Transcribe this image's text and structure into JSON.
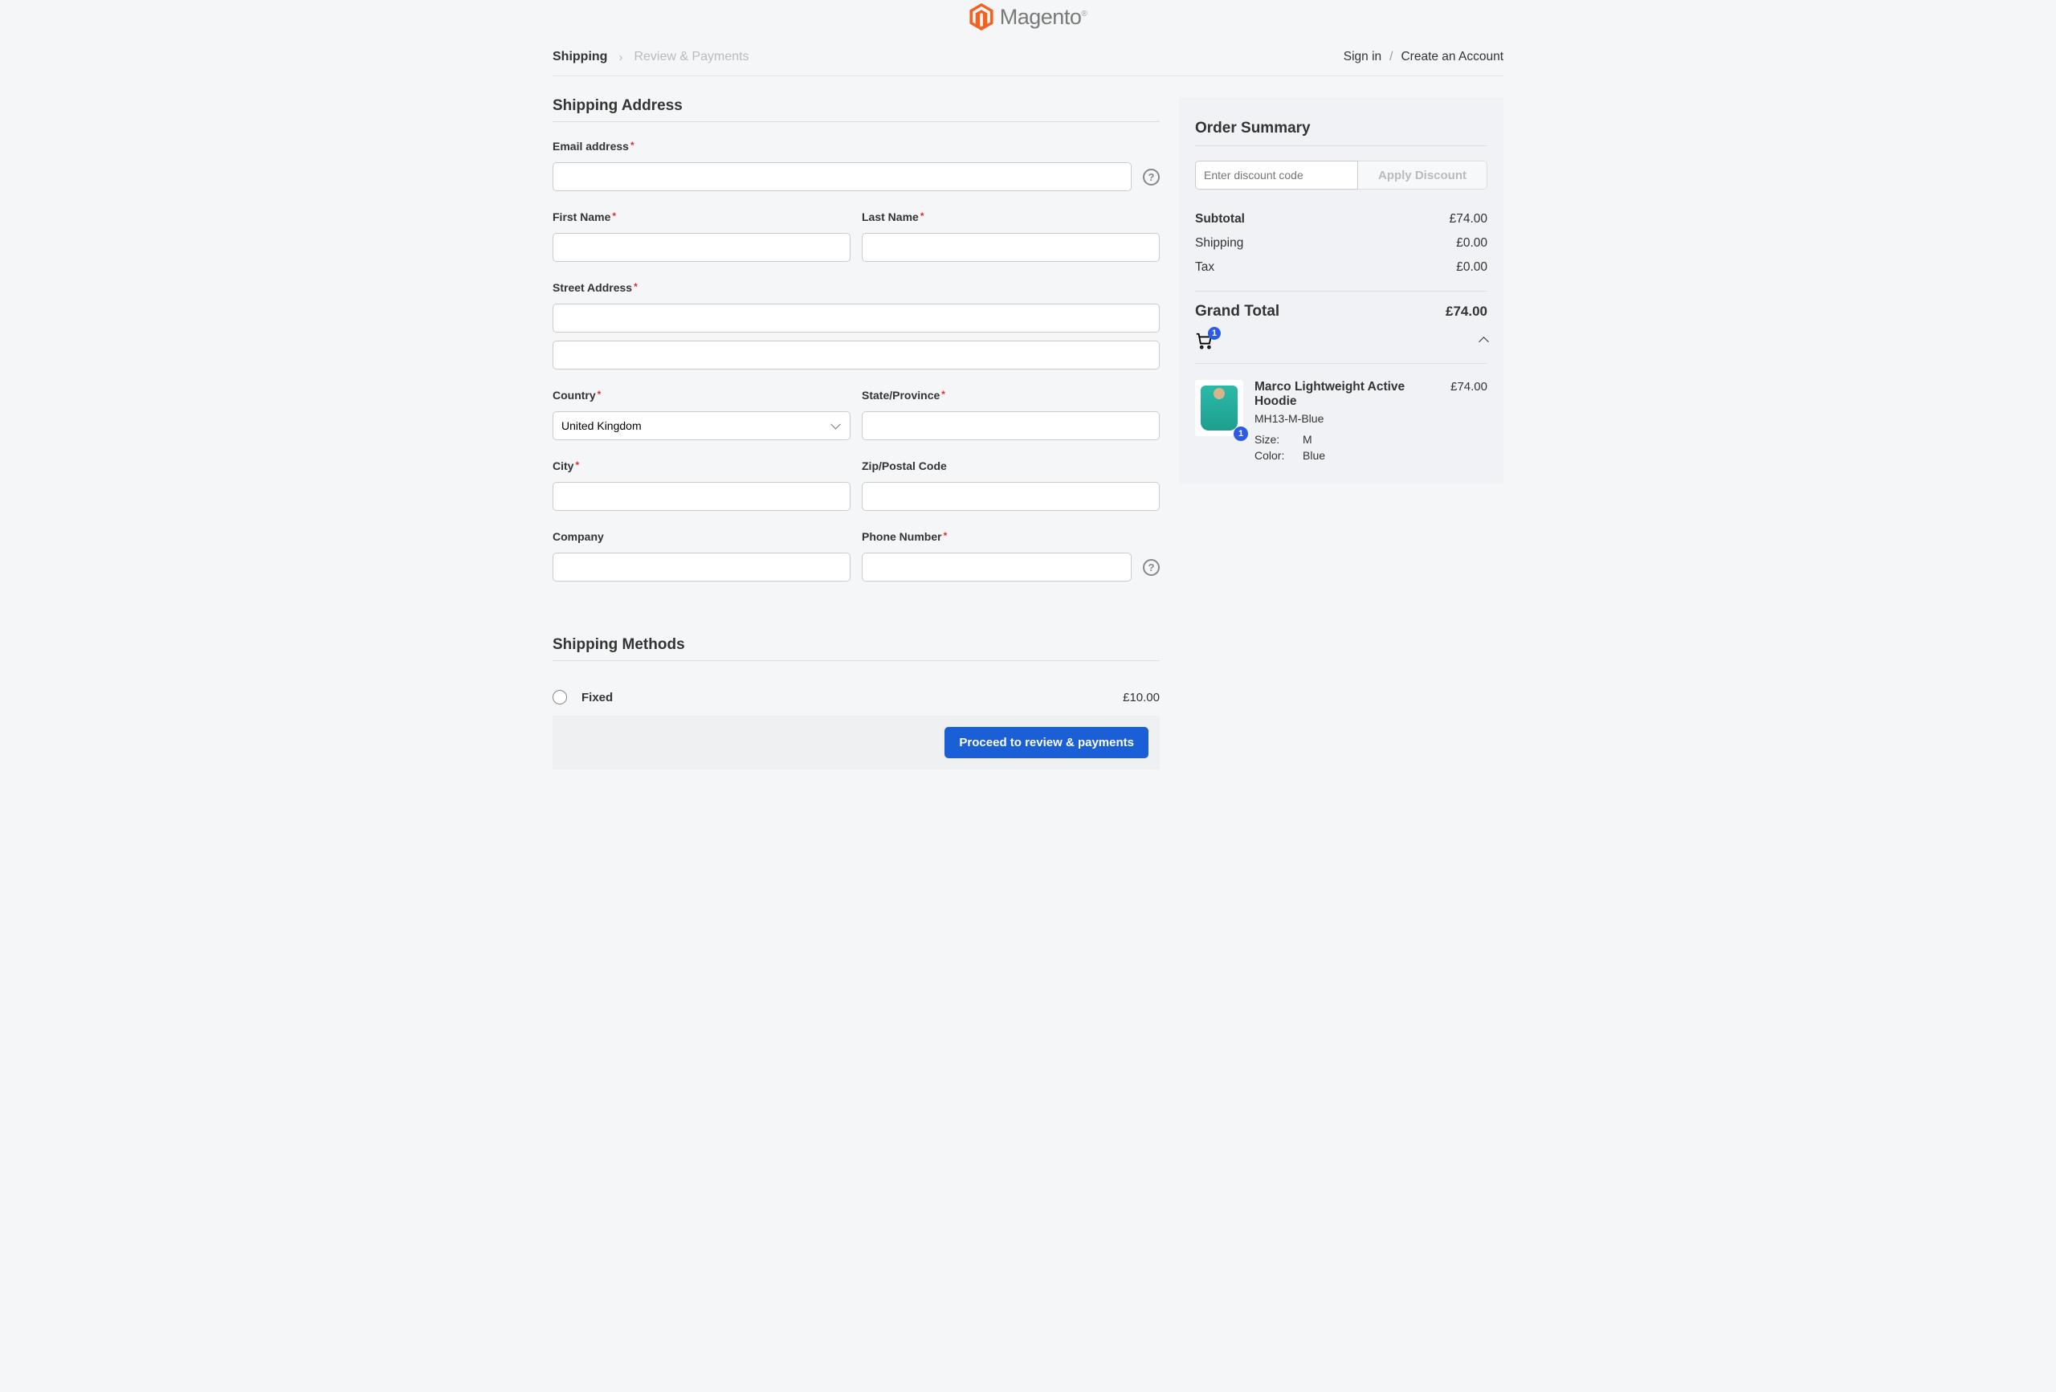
{
  "brand": {
    "name": "Magento"
  },
  "breadcrumbs": {
    "shipping": "Shipping",
    "review": "Review & Payments"
  },
  "auth": {
    "signin": "Sign in",
    "create": "Create an Account"
  },
  "shipping_address": {
    "title": "Shipping Address",
    "email_label": "Email address",
    "firstname_label": "First Name",
    "lastname_label": "Last Name",
    "street_label": "Street Address",
    "country_label": "Country",
    "country_value": "United Kingdom",
    "state_label": "State/Province",
    "city_label": "City",
    "zip_label": "Zip/Postal Code",
    "company_label": "Company",
    "phone_label": "Phone Number"
  },
  "shipping_methods": {
    "title": "Shipping Methods",
    "fixed_label": "Fixed",
    "fixed_price": "£10.00"
  },
  "proceed_label": "Proceed to review & payments",
  "summary": {
    "title": "Order Summary",
    "discount_placeholder": "Enter discount code",
    "discount_button": "Apply Discount",
    "subtotal_label": "Subtotal",
    "subtotal_value": "£74.00",
    "shipping_label": "Shipping",
    "shipping_value": "£0.00",
    "tax_label": "Tax",
    "tax_value": "£0.00",
    "grand_label": "Grand Total",
    "grand_value": "£74.00",
    "cart_count": "1"
  },
  "cart_item": {
    "name": "Marco Lightweight Active Hoodie",
    "sku": "MH13-M-Blue",
    "price": "£74.00",
    "qty": "1",
    "size_label": "Size:",
    "size_value": "M",
    "color_label": "Color:",
    "color_value": "Blue"
  }
}
